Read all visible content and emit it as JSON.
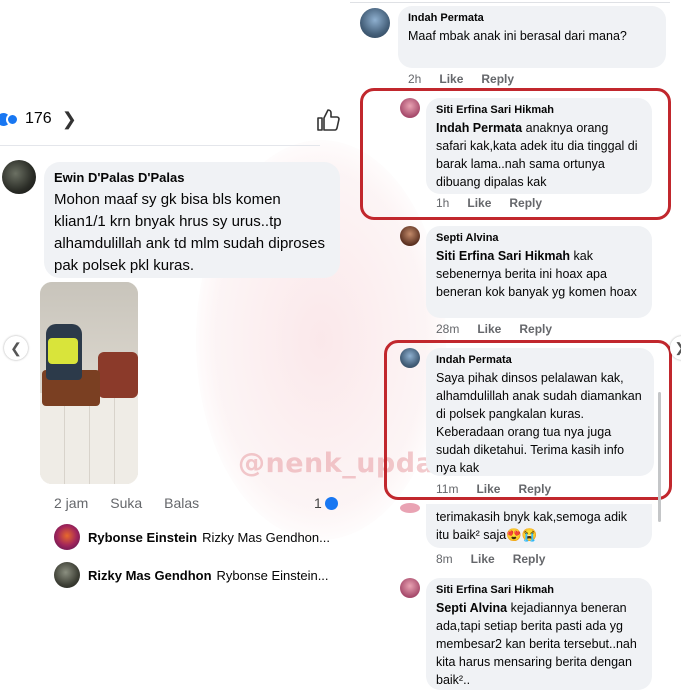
{
  "left": {
    "reaction_count": "176",
    "comment": {
      "author": "Ewin D'Palas D'Palas",
      "text": "Mohon maaf  sy gk bisa bls komen klian1/1 krn bnyak hrus sy urus..tp alhamdulillah ank td mlm sudah diproses pak polsek pkl kuras.",
      "time": "2 jam",
      "like_label": "Suka",
      "reply_label": "Balas",
      "likes": "1"
    },
    "replies": [
      {
        "author": "Rybonse Einstein",
        "preview": "Rizky Mas Gendhon..."
      },
      {
        "author": "Rizky Mas Gendhon",
        "preview": "Rybonse Einstein..."
      }
    ]
  },
  "right": {
    "comments": [
      {
        "author": "Indah Permata",
        "mention": "",
        "text": "Maaf mbak anak ini berasal dari mana?",
        "time": "2h",
        "like": "Like",
        "reply": "Reply"
      },
      {
        "author": "Siti Erfina Sari Hikmah",
        "mention": "Indah Permata",
        "text": " anaknya orang safari kak,kata adek itu dia tinggal di barak lama..nah sama ortunya dibuang dipalas kak",
        "time": "1h",
        "like": "Like",
        "reply": "Reply"
      },
      {
        "author": "Septi Alvina",
        "mention": "Siti Erfina Sari Hikmah",
        "text": " kak sebenernya berita ini hoax apa beneran kok banyak yg komen hoax",
        "time": "28m",
        "like": "Like",
        "reply": "Reply"
      },
      {
        "author": "Indah Permata",
        "mention": "",
        "text": "Saya pihak dinsos pelalawan kak, alhamdulillah anak sudah diamankan di polsek pangkalan kuras. Keberadaan orang tua nya juga sudah diketahui. Terima kasih info nya kak",
        "time": "11m",
        "like": "Like",
        "reply": "Reply"
      },
      {
        "author": "",
        "mention": "",
        "text": "terimakasih bnyk kak,semoga adik itu baik² saja😍😭",
        "time": "8m",
        "like": "Like",
        "reply": "Reply"
      },
      {
        "author": "Siti Erfina Sari Hikmah",
        "mention": "Septi Alvina",
        "text": " kejadiannya beneran ada,tapi setiap berita pasti ada yg membesar2 kan berita tersebut..nah kita harus mensaring berita dengan baik²..",
        "time": "",
        "like": "",
        "reply": ""
      }
    ]
  },
  "watermark": "@nenk_update",
  "colors": {
    "highlight_border": "#c1272d",
    "bubble_bg": "#f0f2f5",
    "meta_text": "#65676b",
    "fb_blue": "#1877f2"
  },
  "icons": [
    "like-reaction-icon",
    "love-reaction-icon",
    "chevron-right-icon",
    "thumbs-up-icon",
    "carousel-prev-icon",
    "carousel-next-icon"
  ]
}
